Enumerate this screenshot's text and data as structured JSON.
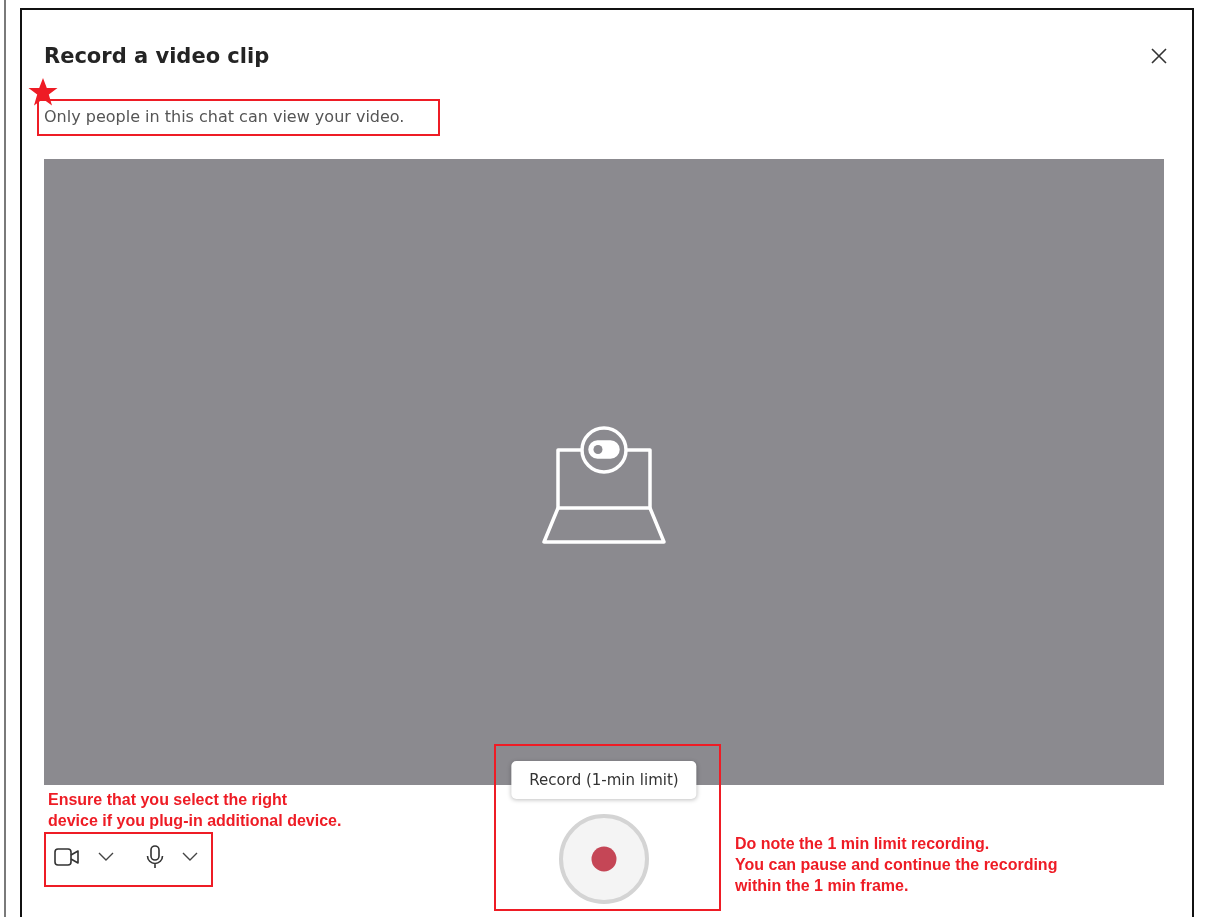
{
  "dialog": {
    "title": "Record a video clip",
    "privacy_note": "Only people in this chat can view your video."
  },
  "record": {
    "tooltip": "Record (1-min limit)"
  },
  "annotation_notes": [
    {
      "lines": [
        "Ensure that you select the right",
        "device if you plug-in additional device."
      ]
    },
    {
      "lines": [
        "Do note the 1 min limit recording.",
        "You can pause and continue the recording",
        "within the 1 min frame."
      ]
    }
  ]
}
